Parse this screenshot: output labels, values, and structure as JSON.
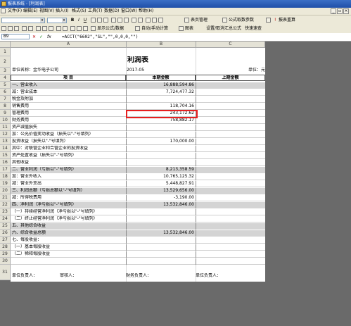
{
  "window": {
    "title": "报表系统 - [利润表]"
  },
  "menu": [
    "文件(F)",
    "编辑(E)",
    "视图(V)",
    "插入(I)",
    "格式(S)",
    "工具(T)",
    "数据(D)",
    "窗口(W)",
    "帮助(H)"
  ],
  "toolbar1": {
    "font_size_box": "",
    "bold": "B",
    "italic": "I",
    "underline": "U",
    "btn_table_manage": "表页管理",
    "btn_formula_data": "公式取数参数",
    "btn_report_recalc": "报表重算"
  },
  "toolbar2": {
    "btn_formula_data": "显示公式/数据",
    "btn_auto_calc": "自动/手动计算",
    "btn_chart": "图表",
    "btn_settings": "设置/取消汇总公式",
    "btn_quick_audit": "快速速查"
  },
  "formula_bar": {
    "cell_ref": "B9",
    "formula": "=ACCT(\"6602\",\"SL\",\"\",0,0,0,\"\")"
  },
  "columns": [
    "A",
    "B",
    "C"
  ],
  "sheet": {
    "title": "利润表",
    "company_label": "单位名称：金华电子公司",
    "period": "2017-05",
    "unit_label": "单位：元",
    "headers": {
      "item": "项      目",
      "current": "本期金额",
      "prior": "上期金额"
    },
    "rows": [
      {
        "num": "5",
        "label": "一、营业收入",
        "amount": "16,888,594.86",
        "grey": true
      },
      {
        "num": "6",
        "label": "   减：营业成本",
        "amount": "7,724,477.32",
        "grey": false
      },
      {
        "num": "7",
        "label": "        税金及附加",
        "amount": "",
        "grey": false
      },
      {
        "num": "8",
        "label": "        销售费用",
        "amount": "118,704.16",
        "grey": false
      },
      {
        "num": "9",
        "label": "        管理费用",
        "amount": "243,172.62",
        "grey": false
      },
      {
        "num": "10",
        "label": "        财务费用",
        "amount": "758,882.17",
        "grey": false
      },
      {
        "num": "11",
        "label": "        资产减值损失",
        "amount": "",
        "grey": false
      },
      {
        "num": "12",
        "label": "   加：公允价值变动收益（损失以\"-\"号填列）",
        "amount": "",
        "grey": false
      },
      {
        "num": "13",
        "label": "        投资收益（损失以\"-\"号填列）",
        "amount": "170,000.00",
        "grey": false
      },
      {
        "num": "14",
        "label": "          其中：对联营企业和合营企业的投资收益",
        "amount": "",
        "grey": false
      },
      {
        "num": "15",
        "label": "        资产处置收益（损失以\"-\"号填列）",
        "amount": "",
        "grey": false
      },
      {
        "num": "16",
        "label": "        其他收益",
        "amount": "",
        "grey": false
      },
      {
        "num": "17",
        "label": "二、营业利润（亏损以\"-\"号填列）",
        "amount": "8,213,358.59",
        "grey": true
      },
      {
        "num": "18",
        "label": "   加：营业外收入",
        "amount": "10,765,125.32",
        "grey": false
      },
      {
        "num": "19",
        "label": "   减：营业外支出",
        "amount": "5,448,827.91",
        "grey": false
      },
      {
        "num": "20",
        "label": "三、利润总额（亏损总额以\"-\"号填列）",
        "amount": "13,529,656.00",
        "grey": true
      },
      {
        "num": "21",
        "label": "   减：所得税费用",
        "amount": "-3,190.00",
        "grey": false
      },
      {
        "num": "22",
        "label": "四、净利润（净亏损以\"-\"号填列）",
        "amount": "13,532,846.00",
        "grey": true
      },
      {
        "num": "23",
        "label": "（一）持续经营净利润（净亏损以\"-\"号填列）",
        "amount": "",
        "grey": false
      },
      {
        "num": "24",
        "label": "（二）终止经营净利润（净亏损以\"-\"号填列）",
        "amount": "",
        "grey": false
      },
      {
        "num": "25",
        "label": "五、其他综合收益",
        "amount": "",
        "grey": true
      },
      {
        "num": "26",
        "label": "六、综合收益总额",
        "amount": "13,532,846.00",
        "grey": true
      },
      {
        "num": "27",
        "label": "七、每股收益：",
        "amount": "",
        "grey": false
      },
      {
        "num": "28",
        "label": "（一）基本每股收益",
        "amount": "",
        "grey": false
      },
      {
        "num": "29",
        "label": "（二）稀释每股收益",
        "amount": "",
        "grey": false
      },
      {
        "num": "30",
        "label": "",
        "amount": "",
        "grey": false
      }
    ],
    "footer": {
      "unit_head": "单位负责人：",
      "preparer": "审核人：",
      "finance_head": "财务负责人：",
      "unit_head2": "单位负责人："
    }
  },
  "colors": {
    "highlight": "#e62020",
    "titlebar": "#1f4fa8"
  }
}
